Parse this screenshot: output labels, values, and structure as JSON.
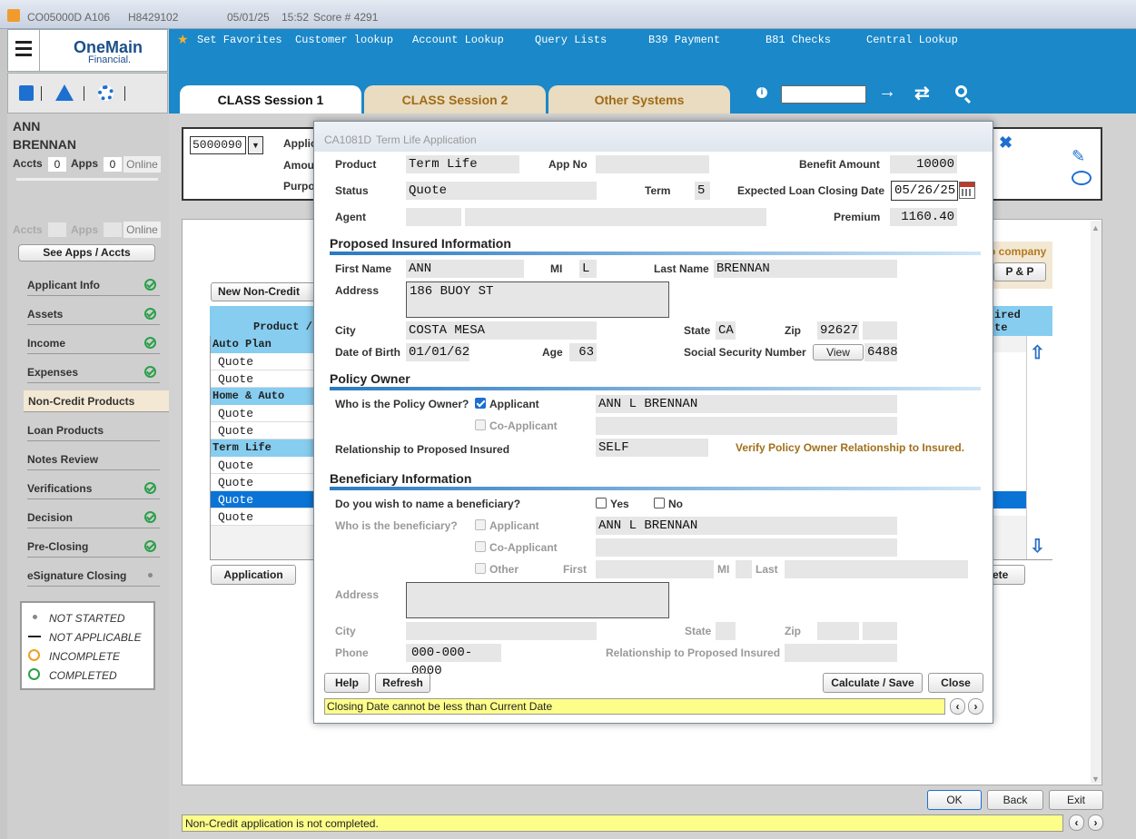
{
  "titlebar": {
    "code": "CO05000D",
    "branch": "A106",
    "id": "H8429102",
    "date": "05/01/25",
    "time": "15:52",
    "score": "Score # 4291"
  },
  "logo": {
    "line1": "OneMain",
    "line2": "Financial."
  },
  "nav": {
    "favorites": "Set Favorites",
    "links": [
      "Customer lookup",
      "Account Lookup",
      "Query Lists",
      "B39 Payment",
      "B81 Checks",
      "Central Lookup"
    ]
  },
  "tabs": [
    "CLASS Session 1",
    "CLASS Session 2",
    "Other Systems"
  ],
  "customer": {
    "first": "ANN",
    "last": "BRENNAN",
    "accts_label": "Accts",
    "accts": "0",
    "apps_label": "Apps",
    "apps": "0",
    "online": "Online"
  },
  "sidebar2": {
    "accts": "Accts",
    "apps": "Apps",
    "online": "Online",
    "see": "See Apps / Accts"
  },
  "steps": [
    {
      "label": "Applicant Info",
      "status": "completed"
    },
    {
      "label": "Assets",
      "status": "completed"
    },
    {
      "label": "Income",
      "status": "completed"
    },
    {
      "label": "Expenses",
      "status": "completed"
    },
    {
      "label": "Non-Credit Products",
      "status": "active"
    },
    {
      "label": "Loan Products",
      "status": "none"
    },
    {
      "label": "Notes Review",
      "status": "none"
    },
    {
      "label": "Verifications",
      "status": "completed"
    },
    {
      "label": "Decision",
      "status": "completed"
    },
    {
      "label": "Pre-Closing",
      "status": "completed"
    },
    {
      "label": "eSignature Closing",
      "status": "notstarted"
    }
  ],
  "legend": [
    "NOT STARTED",
    "NOT APPLICABLE",
    "INCOMPLETE",
    "COMPLETED"
  ],
  "header": {
    "app_select": "5000090",
    "applic": "Applic",
    "amount": "Amou",
    "purpose": "Purpo"
  },
  "behind": {
    "new_btn": "New Non-Credit Quo",
    "product_col": "Product /",
    "groups": [
      {
        "name": "Auto Plan",
        "rows": [
          "Quote",
          "Quote"
        ]
      },
      {
        "name": "Home & Auto Plan",
        "rows": [
          "Quote",
          "Quote"
        ]
      },
      {
        "name": "Term Life",
        "rows": [
          "Quote",
          "Quote",
          "Quote",
          "Quote"
        ]
      }
    ],
    "application_btn": "Application",
    "right_col": "ired",
    "right_col2": "te",
    "company": "o company",
    "pp": "P & P",
    "complete_frag": "ete"
  },
  "dialog": {
    "title_code": "CA1081D",
    "title": "Term Life Application",
    "product_label": "Product",
    "product": "Term Life",
    "appno_label": "App No",
    "appno": "",
    "benefit_label": "Benefit Amount",
    "benefit": "10000",
    "status_label": "Status",
    "status": "Quote",
    "term_label": "Term",
    "term": "5",
    "closing_label": "Expected Loan Closing Date",
    "closing": "05/26/25",
    "agent_label": "Agent",
    "premium_label": "Premium",
    "premium": "1160.40",
    "sec_insured": "Proposed Insured Information",
    "first_label": "First Name",
    "first": "ANN",
    "mi_label": "MI",
    "mi": "L",
    "last_label": "Last Name",
    "last": "BRENNAN",
    "address_label": "Address",
    "address": "186 BUOY ST",
    "city_label": "City",
    "city": "COSTA MESA",
    "state_label": "State",
    "state": "CA",
    "zip_label": "Zip",
    "zip": "92627",
    "dob_label": "Date of Birth",
    "dob": "01/01/62",
    "age_label": "Age",
    "age": "63",
    "ssn_label": "Social Security Number",
    "view": "View",
    "ssn": "6488",
    "sec_owner": "Policy Owner",
    "owner_q": "Who is the Policy Owner?",
    "applicant": "Applicant",
    "coapplicant": "Co-Applicant",
    "owner_name": "ANN L BRENNAN",
    "rel_label": "Relationship to Proposed Insured",
    "rel": "SELF",
    "verify_msg": "Verify Policy Owner Relationship to Insured.",
    "sec_benef": "Beneficiary Information",
    "benef_q": "Do you wish to name a beneficiary?",
    "yes": "Yes",
    "no": "No",
    "who_benef": "Who is the beneficiary?",
    "benef_applicant": "Applicant",
    "benef_coapplicant": "Co-Applicant",
    "benef_other": "Other",
    "benef_name": "ANN L BRENNAN",
    "b_first": "First",
    "b_mi": "MI",
    "b_last": "Last",
    "b_address": "Address",
    "b_city": "City",
    "b_state": "State",
    "b_zip": "Zip",
    "b_phone": "Phone",
    "b_phone_val": "000-000-0000",
    "b_rel": "Relationship to Proposed Insured",
    "help": "Help",
    "refresh": "Refresh",
    "calc": "Calculate / Save",
    "close": "Close",
    "message": "Closing Date cannot be less than Current Date"
  },
  "footer": {
    "ok": "OK",
    "back": "Back",
    "exit": "Exit",
    "message": "Non-Credit application is not completed."
  }
}
